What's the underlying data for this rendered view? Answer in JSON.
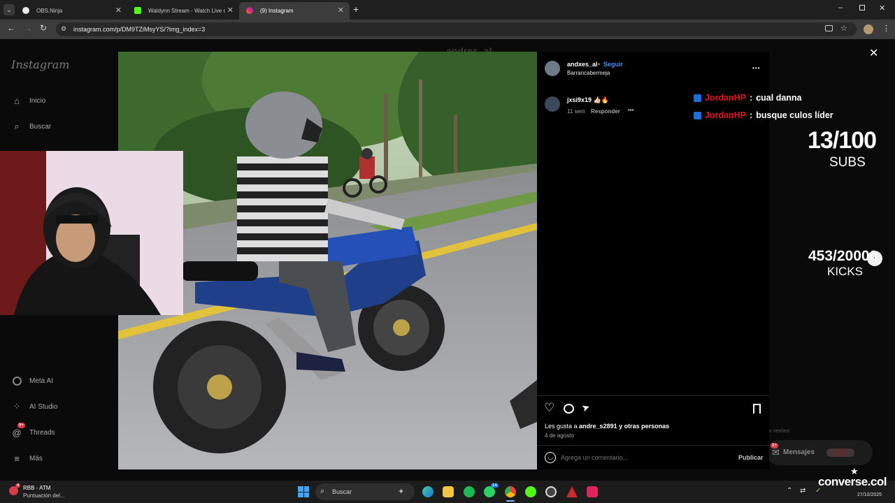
{
  "browser": {
    "tabs": [
      {
        "title": "OBS.Ninja",
        "icon": "obs-ninja-icon",
        "active": false
      },
      {
        "title": "Waldynn Stream - Watch Live o",
        "icon": "kick-icon",
        "active": false
      },
      {
        "title": "(9) Instagram",
        "icon": "instagram-icon",
        "active": true
      }
    ],
    "new_tab_label": "+",
    "url": "instagram.com/p/DM9TZiMsyYS/?img_index=3"
  },
  "sidebar": {
    "logo": "Instagram",
    "items_top": [
      {
        "label": "Inicio",
        "icon": "home-icon"
      },
      {
        "label": "Buscar",
        "icon": "search-icon"
      }
    ],
    "items_bottom": [
      {
        "label": "Meta AI",
        "icon": "meta-ai-icon"
      },
      {
        "label": "AI Studio",
        "icon": "ai-studio-icon"
      },
      {
        "label": "Threads",
        "icon": "threads-icon",
        "badge": "9+"
      },
      {
        "label": "Más",
        "icon": "menu-icon"
      }
    ]
  },
  "behind_modal_text": "andres_al",
  "post": {
    "author": "andxes_al",
    "follow": "Seguir",
    "separator": "•",
    "location": "Barrancabermeja",
    "more_options": "•••",
    "comment": {
      "user": "jxsi9x19",
      "text": "👍🏻🔥",
      "time": "11 sem",
      "reply": "Responder",
      "more": "•••"
    },
    "likes": {
      "prefix": "Les gusta a ",
      "user": "andre_s2891",
      "suffix": " y otras personas"
    },
    "date": "4 de agosto",
    "comment_placeholder": "Agrega un comentario...",
    "publish": "Publicar"
  },
  "messages_bar": {
    "label": "Mensajes",
    "badge": "9+",
    "verified_text": "s Verified"
  },
  "stream_overlay": {
    "chat": [
      {
        "user": "JordanHP",
        "message": "cual danna"
      },
      {
        "user": "JordanHP",
        "message": "busque culos líder"
      }
    ],
    "chat_separator": ":",
    "subs_value": "13/100",
    "subs_label": "SUBS",
    "kicks_value": "453/20000",
    "kicks_label": "KICKS",
    "brand": "converse.col"
  },
  "taskbar": {
    "notification_title": "RBB - ATM",
    "notification_sub": "Puntuación del...",
    "notification_badge": "4",
    "search_placeholder": "Buscar",
    "whatsapp_badge": "14",
    "date": "27/10/2025"
  },
  "colors": {
    "accent_blue": "#4f8cf7",
    "chat_user_red": "#e4151f",
    "instagram_bg": "#000000"
  }
}
